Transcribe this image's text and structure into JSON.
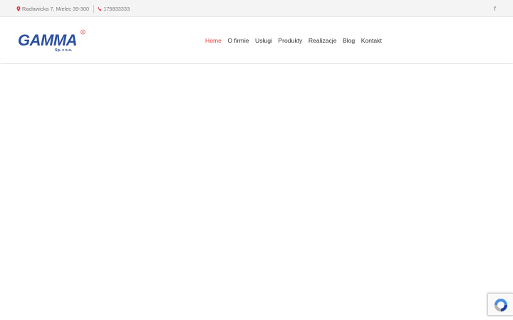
{
  "topbar": {
    "address": "Racławicka 7, Mielec 39-300",
    "phone": "175833333",
    "social": "f"
  },
  "logo": {
    "name": "GAMMA",
    "sub": "Sp. z o.o.",
    "registered": "R"
  },
  "nav": {
    "items": [
      "Home",
      "O firmie",
      "Usługi",
      "Produkty",
      "Realizacje",
      "Blog",
      "Kontakt"
    ]
  },
  "colors": {
    "accent": "#e23a3a",
    "logo_blue": "#2a4fa0",
    "logo_red": "#e03030",
    "topbar_bg": "#f4f4f4"
  },
  "icons": {
    "address": "map-marker-icon",
    "phone": "phone-icon",
    "social": "facebook-icon",
    "recaptcha": "recaptcha-icon"
  }
}
